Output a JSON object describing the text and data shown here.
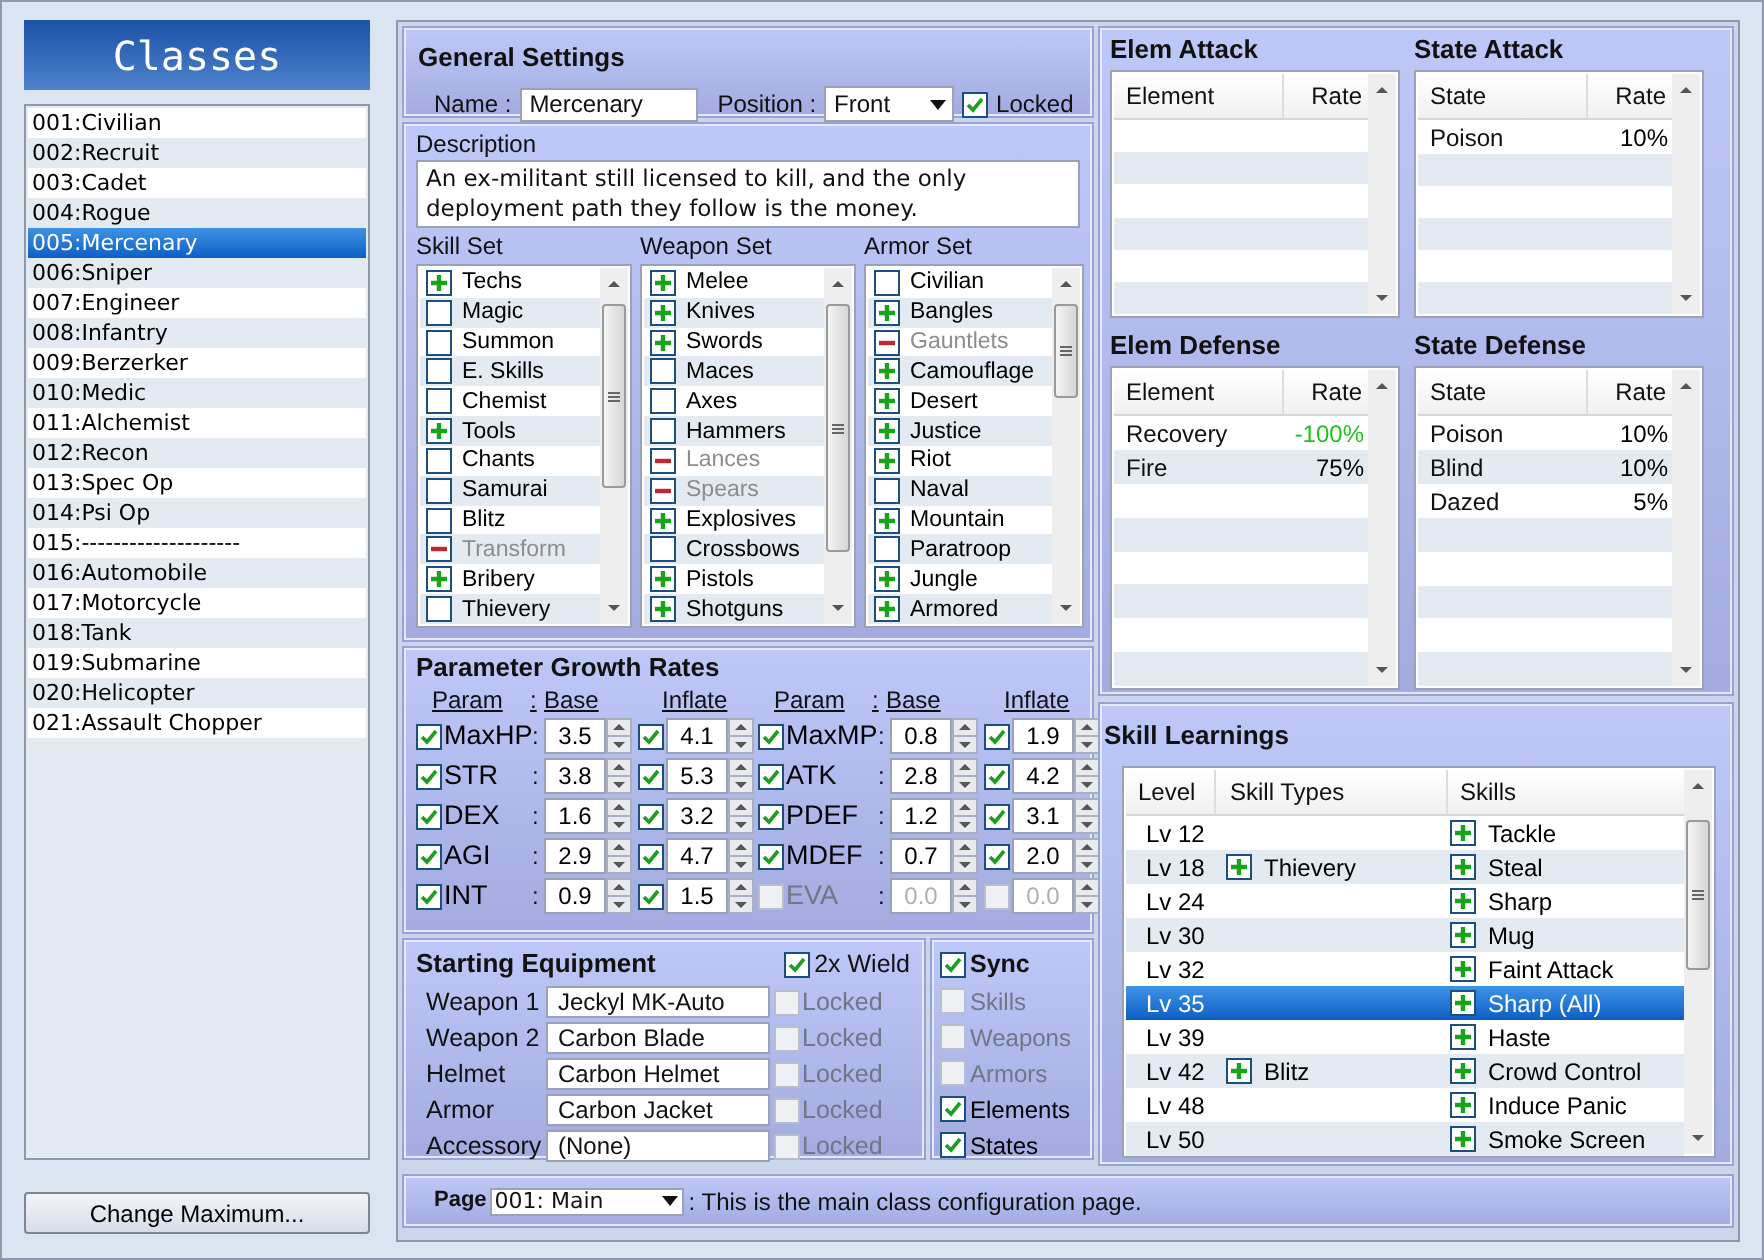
{
  "sidebar": {
    "title": "Classes",
    "items": [
      {
        "label": "001:Civilian",
        "selected": false
      },
      {
        "label": "002:Recruit",
        "selected": false
      },
      {
        "label": "003:Cadet",
        "selected": false
      },
      {
        "label": "004:Rogue",
        "selected": false
      },
      {
        "label": "005:Mercenary",
        "selected": true
      },
      {
        "label": "006:Sniper",
        "selected": false
      },
      {
        "label": "007:Engineer",
        "selected": false
      },
      {
        "label": "008:Infantry",
        "selected": false
      },
      {
        "label": "009:Berzerker",
        "selected": false
      },
      {
        "label": "010:Medic",
        "selected": false
      },
      {
        "label": "011:Alchemist",
        "selected": false
      },
      {
        "label": "012:Recon",
        "selected": false
      },
      {
        "label": "013:Spec Op",
        "selected": false
      },
      {
        "label": "014:Psi Op",
        "selected": false
      },
      {
        "label": "015:--------------------",
        "selected": false
      },
      {
        "label": "016:Automobile",
        "selected": false
      },
      {
        "label": "017:Motorcycle",
        "selected": false
      },
      {
        "label": "018:Tank",
        "selected": false
      },
      {
        "label": "019:Submarine",
        "selected": false
      },
      {
        "label": "020:Helicopter",
        "selected": false
      },
      {
        "label": "021:Assault Chopper",
        "selected": false
      }
    ],
    "button": "Change Maximum..."
  },
  "general_settings": {
    "title": "General Settings",
    "name_label": "Name :",
    "name": "Mercenary",
    "position_label": "Position :",
    "position": "Front",
    "locked": {
      "label": "Locked",
      "checked": true
    }
  },
  "description": {
    "title": "Description",
    "text": "An ex-militant still licensed to kill, and the only deployment path they follow is the money."
  },
  "sets": [
    {
      "title": "Skill Set",
      "items": [
        {
          "label": "Techs",
          "kind": "plus"
        },
        {
          "label": "Magic",
          "kind": "none"
        },
        {
          "label": "Summon",
          "kind": "none"
        },
        {
          "label": "E. Skills",
          "kind": "none"
        },
        {
          "label": "Chemist",
          "kind": "none"
        },
        {
          "label": "Tools",
          "kind": "plus"
        },
        {
          "label": "Chants",
          "kind": "none"
        },
        {
          "label": "Samurai",
          "kind": "none"
        },
        {
          "label": "Blitz",
          "kind": "none"
        },
        {
          "label": "Transform",
          "kind": "minus"
        },
        {
          "label": "Bribery",
          "kind": "plus"
        },
        {
          "label": "Thievery",
          "kind": "none"
        }
      ]
    },
    {
      "title": "Weapon Set",
      "items": [
        {
          "label": "Melee",
          "kind": "plus"
        },
        {
          "label": "Knives",
          "kind": "plus"
        },
        {
          "label": "Swords",
          "kind": "plus"
        },
        {
          "label": "Maces",
          "kind": "none"
        },
        {
          "label": "Axes",
          "kind": "none"
        },
        {
          "label": "Hammers",
          "kind": "none"
        },
        {
          "label": "Lances",
          "kind": "minus"
        },
        {
          "label": "Spears",
          "kind": "minus"
        },
        {
          "label": "Explosives",
          "kind": "plus"
        },
        {
          "label": "Crossbows",
          "kind": "none"
        },
        {
          "label": "Pistols",
          "kind": "plus"
        },
        {
          "label": "Shotguns",
          "kind": "plus"
        }
      ]
    },
    {
      "title": "Armor Set",
      "items": [
        {
          "label": "Civilian",
          "kind": "none"
        },
        {
          "label": "Bangles",
          "kind": "plus"
        },
        {
          "label": "Gauntlets",
          "kind": "minus"
        },
        {
          "label": "Camouflage",
          "kind": "plus"
        },
        {
          "label": "Desert",
          "kind": "plus"
        },
        {
          "label": "Justice",
          "kind": "plus"
        },
        {
          "label": "Riot",
          "kind": "plus"
        },
        {
          "label": "Naval",
          "kind": "none"
        },
        {
          "label": "Mountain",
          "kind": "plus"
        },
        {
          "label": "Paratroop",
          "kind": "none"
        },
        {
          "label": "Jungle",
          "kind": "plus"
        },
        {
          "label": "Armored",
          "kind": "plus"
        }
      ]
    }
  ],
  "growth": {
    "title": "Parameter Growth Rates",
    "groups": [
      {
        "header": {
          "param": "Param",
          "sep": ":",
          "base": "Base",
          "inflate": "Inflate"
        },
        "rows": [
          {
            "label": "MaxHP",
            "checked": true,
            "sep": ":",
            "base": "3.5",
            "inflate_checked": true,
            "inflate": "4.1"
          },
          {
            "label": "STR",
            "checked": true,
            "sep": ":",
            "base": "3.8",
            "inflate_checked": true,
            "inflate": "5.3"
          },
          {
            "label": "DEX",
            "checked": true,
            "sep": ":",
            "base": "1.6",
            "inflate_checked": true,
            "inflate": "3.2"
          },
          {
            "label": "AGI",
            "checked": true,
            "sep": ":",
            "base": "2.9",
            "inflate_checked": true,
            "inflate": "4.7"
          },
          {
            "label": "INT",
            "checked": true,
            "sep": ":",
            "base": "0.9",
            "inflate_checked": true,
            "inflate": "1.5"
          }
        ]
      },
      {
        "header": {
          "param": "Param",
          "sep": ":",
          "base": "Base",
          "inflate": "Inflate"
        },
        "rows": [
          {
            "label": "MaxMP",
            "checked": true,
            "sep": ":",
            "base": "0.8",
            "inflate_checked": true,
            "inflate": "1.9"
          },
          {
            "label": "ATK",
            "checked": true,
            "sep": ":",
            "base": "2.8",
            "inflate_checked": true,
            "inflate": "4.2"
          },
          {
            "label": "PDEF",
            "checked": true,
            "sep": ":",
            "base": "1.2",
            "inflate_checked": true,
            "inflate": "3.1"
          },
          {
            "label": "MDEF",
            "checked": true,
            "sep": ":",
            "base": "0.7",
            "inflate_checked": true,
            "inflate": "2.0"
          },
          {
            "label": "EVA",
            "checked": false,
            "sep": ":",
            "base": "0.0",
            "inflate_checked": false,
            "inflate": "0.0"
          }
        ]
      }
    ]
  },
  "starting_equipment": {
    "title": "Starting Equipment",
    "dual_wield": {
      "label": "2x Wield",
      "checked": true
    },
    "slots": [
      {
        "label": "Weapon 1",
        "value": "Jeckyl MK-Auto",
        "locked_label": "Locked",
        "locked": false
      },
      {
        "label": "Weapon 2",
        "value": "Carbon Blade",
        "locked_label": "Locked",
        "locked": false
      },
      {
        "label": "Helmet",
        "value": "Carbon Helmet",
        "locked_label": "Locked",
        "locked": false
      },
      {
        "label": "Armor",
        "value": "Carbon Jacket",
        "locked_label": "Locked",
        "locked": false
      },
      {
        "label": "Accessory",
        "value": "(None)",
        "locked_label": "Locked",
        "locked": false
      }
    ]
  },
  "sync": {
    "label": "Sync",
    "checked": true,
    "items": [
      {
        "label": "Skills",
        "checked": false
      },
      {
        "label": "Weapons",
        "checked": false
      },
      {
        "label": "Armors",
        "checked": false
      },
      {
        "label": "Elements",
        "checked": true
      },
      {
        "label": "States",
        "checked": true
      }
    ]
  },
  "rate_tables": [
    {
      "title": "Elem Attack",
      "columns": [
        "Element",
        "Rate"
      ]
    },
    {
      "title": "State Attack",
      "columns": [
        "State",
        "Rate"
      ],
      "rows": [
        {
          "name": "Poison",
          "rate": "10%",
          "highlight": false
        }
      ]
    },
    {
      "title": "Elem Defense",
      "columns": [
        "Element",
        "Rate"
      ],
      "rows": [
        {
          "name": "Recovery",
          "rate": "-100%",
          "highlight": true
        },
        {
          "name": "Fire",
          "rate": "75%",
          "highlight": false
        }
      ]
    },
    {
      "title": "State Defense",
      "columns": [
        "State",
        "Rate"
      ],
      "rows": [
        {
          "name": "Poison",
          "rate": "10%",
          "highlight": false
        },
        {
          "name": "Blind",
          "rate": "10%",
          "highlight": false
        },
        {
          "name": "Dazed",
          "rate": "5%",
          "highlight": false
        }
      ]
    }
  ],
  "skill_learnings": {
    "title": "Skill Learnings",
    "columns": [
      "Level",
      "Skill Types",
      "Skills"
    ],
    "rows": [
      {
        "level": "Lv 12",
        "skill": "Tackle",
        "selected": false
      },
      {
        "level": "Lv 18",
        "skill_type": "Thievery",
        "skill": "Steal",
        "selected": false
      },
      {
        "level": "Lv 24",
        "skill": "Sharp",
        "selected": false
      },
      {
        "level": "Lv 30",
        "skill": "Mug",
        "selected": false
      },
      {
        "level": "Lv 32",
        "skill": "Faint Attack",
        "selected": false
      },
      {
        "level": "Lv 35",
        "skill": "Sharp (All)",
        "selected": true
      },
      {
        "level": "Lv 39",
        "skill": "Haste",
        "selected": false
      },
      {
        "level": "Lv 42",
        "skill_type": "Blitz",
        "skill": "Crowd Control",
        "selected": false
      },
      {
        "level": "Lv 48",
        "skill": "Induce Panic",
        "selected": false
      },
      {
        "level": "Lv 50",
        "skill": "Smoke Screen",
        "selected": false
      }
    ]
  },
  "page_bar": {
    "label": "Page",
    "value": "001: Main",
    "text": ": This is the main class configuration page."
  }
}
